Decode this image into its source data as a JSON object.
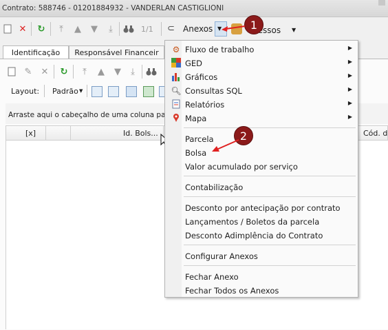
{
  "window": {
    "title": "Contrato: 588746 - 01201884932 - VANDERLAN CASTIGLIONI"
  },
  "toolbar": {
    "page_counter": "1/1",
    "anexos_label": "Anexos",
    "processos_label": "Processos",
    "processos_visible": "cessos"
  },
  "tabs": [
    {
      "label": "Identificação"
    },
    {
      "label": "Responsável Financeiro"
    }
  ],
  "tabs_visible": {
    "resp": "Responsável Financeir"
  },
  "layout_bar": {
    "layout_label": "Layout:",
    "padrao_label": "Padrão"
  },
  "group_hint": "Arraste aqui o cabeçalho de uma coluna para agrupar",
  "group_hint_visible": "Arraste aqui o cabeçalho de uma coluna para ag",
  "grid": {
    "columns": [
      "[x]",
      "",
      "Id. Bols...",
      "Cód. da"
    ]
  },
  "menu": {
    "submenus": [
      {
        "label": "Fluxo de trabalho",
        "icon": "workflow-icon"
      },
      {
        "label": "GED",
        "icon": "ged-icon"
      },
      {
        "label": "Gráficos",
        "icon": "chart-icon"
      },
      {
        "label": "Consultas SQL",
        "icon": "sql-query-icon"
      },
      {
        "label": "Relatórios",
        "icon": "report-icon"
      },
      {
        "label": "Mapa",
        "icon": "map-pin-icon"
      }
    ],
    "group1": [
      "Parcela",
      "Bolsa",
      "Valor acumulado por serviço"
    ],
    "group2": [
      "Contabilização"
    ],
    "group3": [
      "Desconto por antecipação por contrato",
      "Lançamentos / Boletos da parcela",
      "Desconto Adimplência do Contrato"
    ],
    "group4": [
      "Configurar Anexos"
    ],
    "group5": [
      "Fechar Anexo",
      "Fechar Todos os Anexos"
    ]
  },
  "annotations": {
    "badge1": "1",
    "badge2": "2"
  },
  "colors": {
    "badge": "#8b1a1a",
    "arrow": "#e02020"
  }
}
